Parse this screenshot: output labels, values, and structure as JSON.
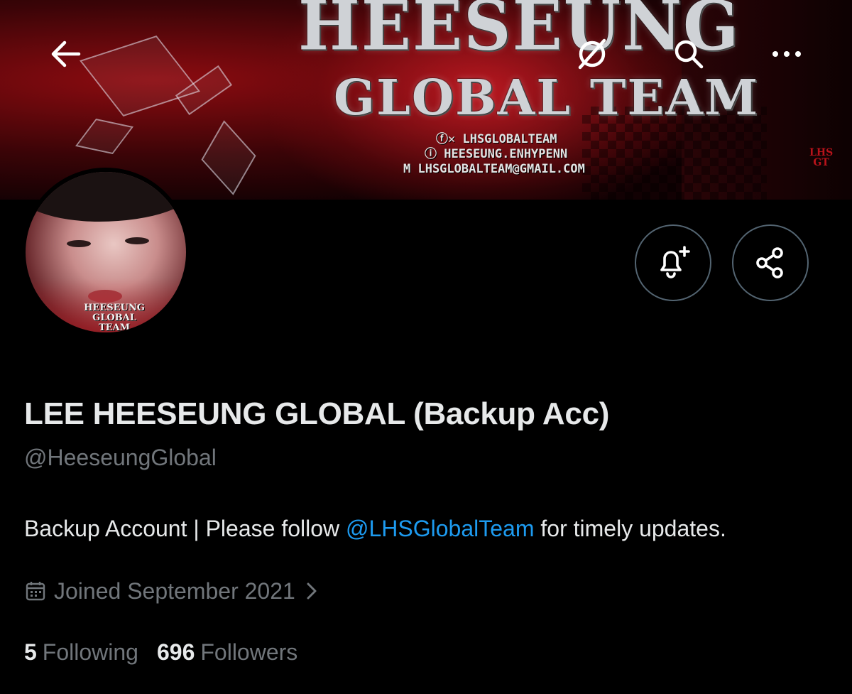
{
  "banner": {
    "title_line1": "HEESEUNG",
    "title_line2": "GLOBAL TEAM",
    "contacts": [
      "ⓕ✕ LHSGLOBALTEAM",
      "ⓘ HEESEUNG.ENHYPENN",
      "M LHSGLOBALTEAM@GMAIL.COM"
    ],
    "badge_line1": "LHS",
    "badge_line2": "GT"
  },
  "header": {
    "back_icon": "back-arrow-icon",
    "no_image_icon": "image-off-icon",
    "search_icon": "search-icon",
    "more_icon": "more-horizontal-icon"
  },
  "avatar": {
    "caption_line1": "HEESEUNG",
    "caption_line2": "GLOBAL TEAM"
  },
  "actions": {
    "notify_icon": "bell-plus-icon",
    "share_icon": "share-icon"
  },
  "profile": {
    "display_name": "LEE HEESEUNG GLOBAL (Backup Acc)",
    "handle": "@HeeseungGlobal",
    "bio_prefix": "Backup Account | Please follow ",
    "bio_mention": "@LHSGlobalTeam",
    "bio_suffix": " for timely updates.",
    "joined": "Joined September 2021",
    "following_count": "5",
    "following_label": "Following",
    "followers_count": "696",
    "followers_label": "Followers"
  },
  "colors": {
    "background": "#000000",
    "text_primary": "#e7e9ea",
    "text_secondary": "#71767b",
    "link": "#1d9bf0",
    "border": "#536471"
  }
}
